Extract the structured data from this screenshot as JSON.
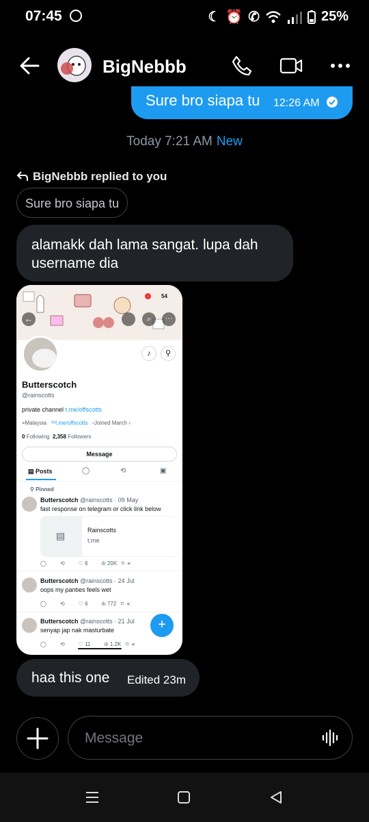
{
  "status_bar": {
    "time": "07:45",
    "battery": "25%"
  },
  "header": {
    "contact_name": "BigNebbb"
  },
  "outgoing": {
    "text": "Sure bro siapa tu",
    "time": "12:26 AM"
  },
  "day_separator": {
    "label": "Today 7:21 AM",
    "new_label": "New"
  },
  "reply": {
    "replied_label": "BigNebbb replied to you",
    "quoted_text": "Sure bro siapa tu"
  },
  "incoming": {
    "text": "alamakk dah lama sangat. lupa dah username dia"
  },
  "shared_screenshot": {
    "banner_badge": "54",
    "profile_name": "Butterscotch",
    "profile_handle": "@rainscotts",
    "bio_prefix": "private channel",
    "bio_link": "t.me/offscotts",
    "location": "Malaysia",
    "link": "t.me/offscotts",
    "joined": "Joined March",
    "following_count": "0",
    "following_label": "Following",
    "followers_count": "2,358",
    "followers_label": "Followers",
    "message_button": "Message",
    "tab_posts": "Posts",
    "pinned_label": "Pinned",
    "posts": [
      {
        "name": "Butterscotch",
        "meta": "@rainscotts · 09 May",
        "text": "fast response on telegram or click link below",
        "card_title": "Rainscotts",
        "card_url": "t.me",
        "likes": "6",
        "views": "20K"
      },
      {
        "name": "Butterscotch",
        "meta": "@rainscotts · 24 Jul",
        "text": "oops my panties feels wet",
        "likes": "6",
        "views": "772"
      },
      {
        "name": "Butterscotch",
        "meta": "@rainscotts · 21 Jul",
        "text": "senyap jap nak masturbate",
        "likes": "11",
        "views": "1.2K"
      }
    ]
  },
  "last_message": {
    "text": "haa this one",
    "edited": "Edited 23m"
  },
  "composer": {
    "placeholder": "Message"
  }
}
